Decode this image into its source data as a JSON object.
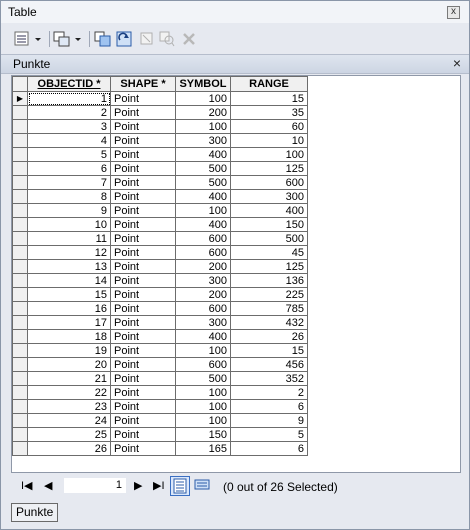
{
  "window": {
    "title": "Table",
    "close": "x"
  },
  "panel": {
    "title": "Punkte",
    "close": "×"
  },
  "table": {
    "columns": [
      "OBJECTID *",
      "SHAPE *",
      "SYMBOL",
      "RANGE"
    ],
    "rows": [
      [
        "1",
        "Point",
        "100",
        "15"
      ],
      [
        "2",
        "Point",
        "200",
        "35"
      ],
      [
        "3",
        "Point",
        "100",
        "60"
      ],
      [
        "4",
        "Point",
        "300",
        "10"
      ],
      [
        "5",
        "Point",
        "400",
        "100"
      ],
      [
        "6",
        "Point",
        "500",
        "125"
      ],
      [
        "7",
        "Point",
        "500",
        "600"
      ],
      [
        "8",
        "Point",
        "400",
        "300"
      ],
      [
        "9",
        "Point",
        "100",
        "400"
      ],
      [
        "10",
        "Point",
        "400",
        "150"
      ],
      [
        "11",
        "Point",
        "600",
        "500"
      ],
      [
        "12",
        "Point",
        "600",
        "45"
      ],
      [
        "13",
        "Point",
        "200",
        "125"
      ],
      [
        "14",
        "Point",
        "300",
        "136"
      ],
      [
        "15",
        "Point",
        "200",
        "225"
      ],
      [
        "16",
        "Point",
        "600",
        "785"
      ],
      [
        "17",
        "Point",
        "300",
        "432"
      ],
      [
        "18",
        "Point",
        "400",
        "26"
      ],
      [
        "19",
        "Point",
        "100",
        "15"
      ],
      [
        "20",
        "Point",
        "600",
        "456"
      ],
      [
        "21",
        "Point",
        "500",
        "352"
      ],
      [
        "22",
        "Point",
        "100",
        "2"
      ],
      [
        "23",
        "Point",
        "100",
        "6"
      ],
      [
        "24",
        "Point",
        "100",
        "9"
      ],
      [
        "25",
        "Point",
        "150",
        "5"
      ],
      [
        "26",
        "Point",
        "165",
        "6"
      ]
    ],
    "current_row_marker": "▶"
  },
  "nav": {
    "first": "I◀",
    "prev": "◀",
    "record": "1",
    "next": "▶",
    "last": "▶I"
  },
  "status": "(0 out of 26 Selected)",
  "tab": {
    "label": "Punkte"
  }
}
